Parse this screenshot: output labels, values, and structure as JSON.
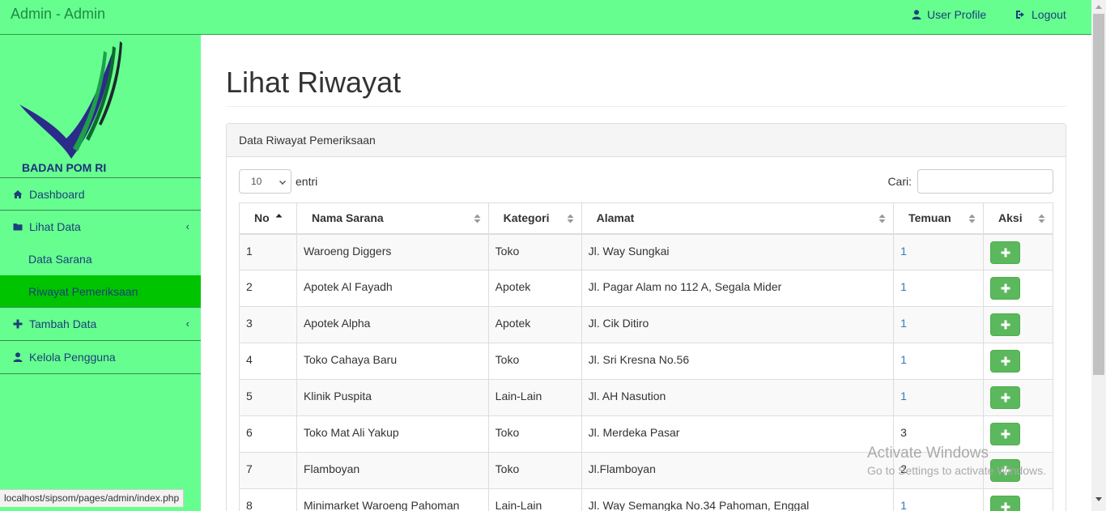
{
  "header": {
    "brand": "Admin - Admin",
    "user_profile": "User Profile",
    "logout": "Logout"
  },
  "sidebar": {
    "logo_text": "BADAN POM RI",
    "items": [
      {
        "label": "Dashboard",
        "icon": "home-icon"
      },
      {
        "label": "Lihat Data",
        "icon": "folder-icon"
      },
      {
        "label": "Data Sarana"
      },
      {
        "label": "Riwayat Pemeriksaan",
        "active": true
      },
      {
        "label": "Tambah Data",
        "icon": "plus-icon"
      },
      {
        "label": "Kelola Pengguna",
        "icon": "user-icon"
      }
    ]
  },
  "main": {
    "title": "Lihat Riwayat",
    "panel_heading": "Data Riwayat Pemeriksaan",
    "length_value": "10",
    "length_label": "entri",
    "search_label": "Cari:",
    "search_value": ""
  },
  "table": {
    "headers": [
      "No",
      "Nama Sarana",
      "Kategori",
      "Alamat",
      "Temuan",
      "Aksi"
    ],
    "rows": [
      {
        "no": "1",
        "nama": "Waroeng Diggers",
        "kategori": "Toko",
        "alamat": "Jl. Way Sungkai",
        "temuan": "1"
      },
      {
        "no": "2",
        "nama": "Apotek Al Fayadh",
        "kategori": "Apotek",
        "alamat": "Jl. Pagar Alam no 112 A, Segala Mider",
        "temuan": "1"
      },
      {
        "no": "3",
        "nama": "Apotek Alpha",
        "kategori": "Apotek",
        "alamat": "Jl. Cik Ditiro",
        "temuan": "1"
      },
      {
        "no": "4",
        "nama": "Toko Cahaya Baru",
        "kategori": "Toko",
        "alamat": "Jl. Sri Kresna No.56",
        "temuan": "1"
      },
      {
        "no": "5",
        "nama": "Klinik Puspita",
        "kategori": "Lain-Lain",
        "alamat": "Jl. AH Nasution",
        "temuan": "1"
      },
      {
        "no": "6",
        "nama": "Toko Mat Ali Yakup",
        "kategori": "Toko",
        "alamat": "Jl. Merdeka Pasar",
        "temuan": "3"
      },
      {
        "no": "7",
        "nama": "Flamboyan",
        "kategori": "Toko",
        "alamat": "Jl.Flamboyan",
        "temuan": "2"
      },
      {
        "no": "8",
        "nama": "Minimarket Waroeng Pahoman",
        "kategori": "Lain-Lain",
        "alamat": "Jl. Way Semangka No.34 Pahoman, Enggal",
        "temuan": "1"
      }
    ]
  },
  "status_bar": "localhost/sipsom/pages/admin/index.php",
  "watermark": {
    "line1": "Activate Windows",
    "line2": "Go to Settings to activate Windows."
  },
  "colors": {
    "header_bg": "#66ff8f",
    "sidebar_active": "#00c400",
    "button_green": "#5cb85c",
    "link_blue": "#337ab7"
  }
}
